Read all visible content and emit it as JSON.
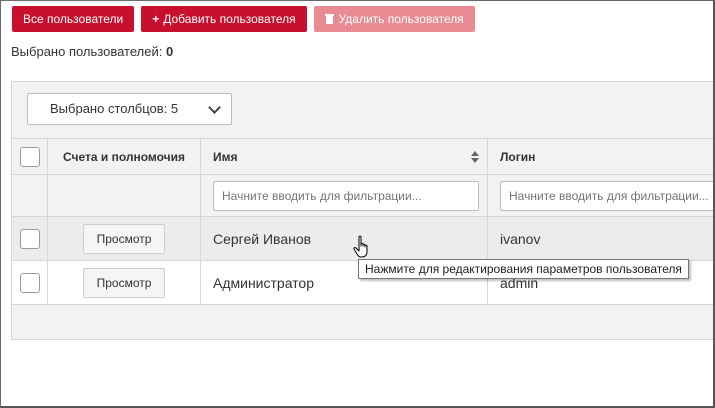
{
  "toolbar": {
    "all_users": "Все пользователи",
    "add_user": "Добавить пользователя",
    "delete_user": "Удалить пользователя"
  },
  "selected": {
    "label": "Выбрано пользователей:",
    "count": "0"
  },
  "columns_select": {
    "label": "Выбрано столбцов: 5"
  },
  "table": {
    "headers": {
      "accounts": "Счета и полномочия",
      "name": "Имя",
      "login": "Логин"
    },
    "filter_placeholder": "Начните вводить для фильтрации...",
    "rows": [
      {
        "view": "Просмотр",
        "name": "Сергей Иванов",
        "login": "ivanov"
      },
      {
        "view": "Просмотр",
        "name": "Администратор",
        "login": "admin"
      }
    ]
  },
  "tooltip": "Нажмите для редактирования параметров пользователя",
  "icons": {
    "add": "plus-icon",
    "delete": "trash-icon",
    "columns": "chevron-down-icon",
    "sort": "sort-icon",
    "cursor": "hand-pointer-icon"
  },
  "colors": {
    "primary": "#c8102e",
    "disabled": "#ea8b94"
  }
}
